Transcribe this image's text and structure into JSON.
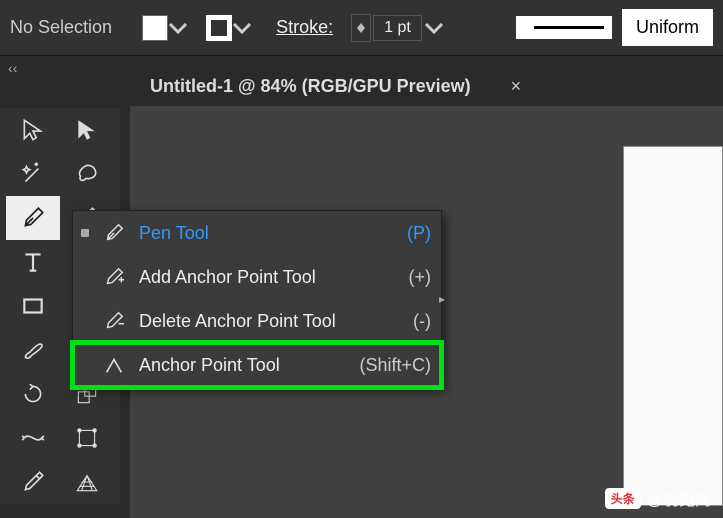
{
  "topbar": {
    "selection": "No Selection",
    "stroke_label": "Stroke:",
    "stroke_value": "1 pt",
    "profile": "Uniform"
  },
  "tab": {
    "title": "Untitled-1 @ 84% (RGB/GPU Preview)",
    "close": "×"
  },
  "collapse": "‹‹",
  "flyout": {
    "items": [
      {
        "label": "Pen Tool",
        "key": "(P)",
        "selected": true,
        "icon": "pen"
      },
      {
        "label": "Add Anchor Point Tool",
        "key": "(+)",
        "selected": false,
        "icon": "pen-plus"
      },
      {
        "label": "Delete Anchor Point Tool",
        "key": "(-)",
        "selected": false,
        "icon": "pen-minus"
      },
      {
        "label": "Anchor Point Tool",
        "key": "(Shift+C)",
        "selected": false,
        "icon": "anchor-convert",
        "highlight": true
      }
    ]
  },
  "watermark": {
    "badge": "头条",
    "text": "@羽兔网"
  }
}
